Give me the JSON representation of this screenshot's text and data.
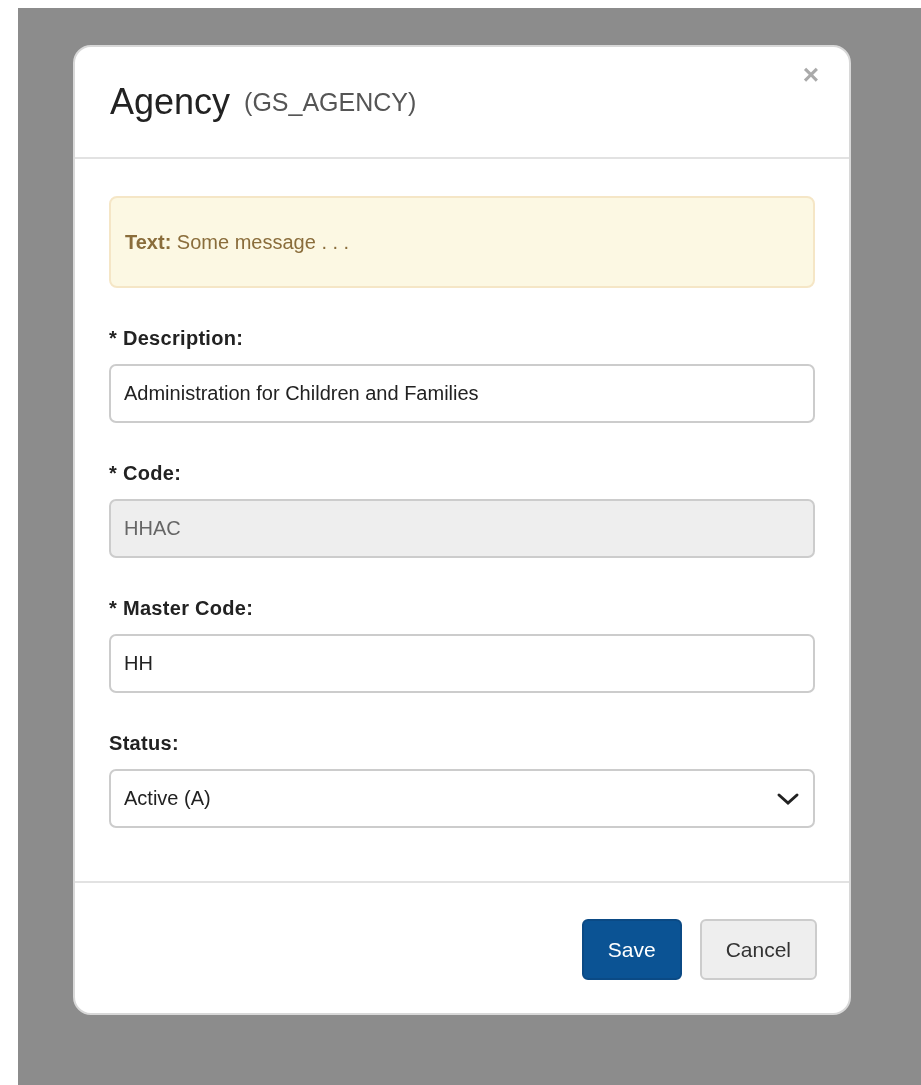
{
  "dialog": {
    "title": "Agency",
    "subtitle": "(GS_AGENCY)",
    "close": "×"
  },
  "alert": {
    "text": "**Text:** Some message . . ."
  },
  "fields": [
    {
      "kind": "text",
      "label": "* Description:",
      "value": "Administration for Children and Families",
      "disabled": false
    },
    {
      "kind": "text",
      "label": "* Code:",
      "value": "HHAC",
      "disabled": true
    },
    {
      "kind": "text",
      "label": "* Master Code:",
      "value": "HH",
      "disabled": false
    },
    {
      "kind": "select",
      "label": "Status:",
      "value": "Active (A)",
      "disabled": false
    }
  ],
  "buttons": [
    {
      "label": "Save",
      "kind": "primary"
    },
    {
      "label": "Cancel",
      "kind": "default"
    }
  ]
}
